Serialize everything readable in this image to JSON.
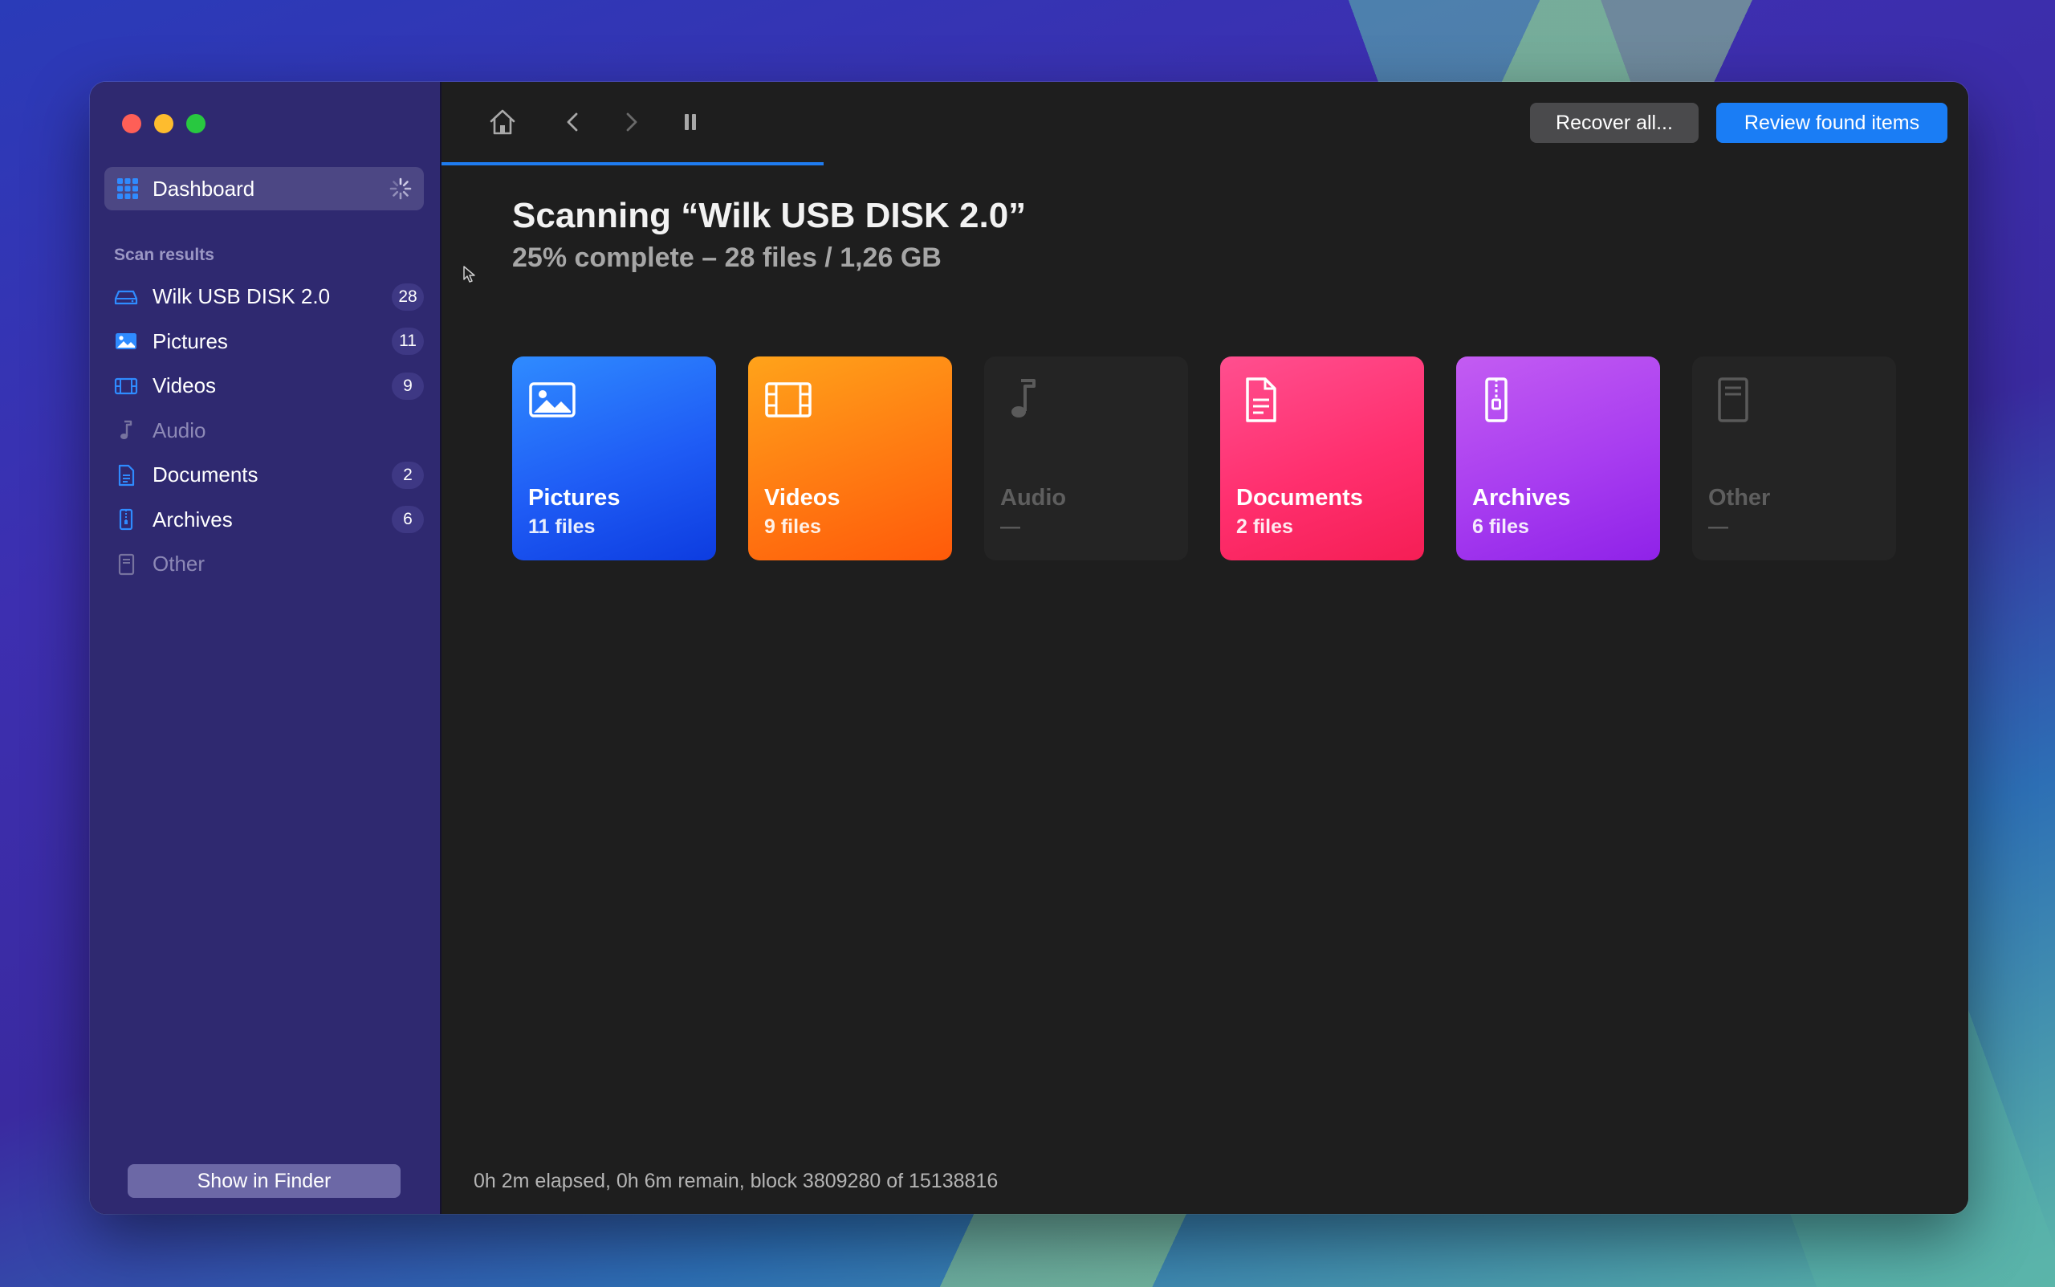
{
  "sidebar": {
    "dashboard_label": "Dashboard",
    "section_label": "Scan results",
    "items": [
      {
        "label": "Wilk USB DISK 2.0",
        "count": "28",
        "icon": "drive-icon",
        "active": true
      },
      {
        "label": "Pictures",
        "count": "11",
        "icon": "picture-icon",
        "active": true
      },
      {
        "label": "Videos",
        "count": "9",
        "icon": "film-icon",
        "active": true
      },
      {
        "label": "Audio",
        "count": "",
        "icon": "music-note-icon",
        "active": false
      },
      {
        "label": "Documents",
        "count": "2",
        "icon": "document-icon",
        "active": true
      },
      {
        "label": "Archives",
        "count": "6",
        "icon": "archive-icon",
        "active": true
      },
      {
        "label": "Other",
        "count": "",
        "icon": "file-icon",
        "active": false
      }
    ],
    "show_in_finder_label": "Show in Finder"
  },
  "toolbar": {
    "recover_all_label": "Recover all...",
    "review_label": "Review found items",
    "scan_progress_fraction": 0.25
  },
  "main": {
    "title": "Scanning “Wilk USB DISK 2.0”",
    "subtitle": "25% complete – 28 files / 1,26 GB",
    "cards": [
      {
        "name": "Pictures",
        "count": "11 files"
      },
      {
        "name": "Videos",
        "count": "9 files"
      },
      {
        "name": "Audio",
        "count": "—"
      },
      {
        "name": "Documents",
        "count": "2 files"
      },
      {
        "name": "Archives",
        "count": "6 files"
      },
      {
        "name": "Other",
        "count": "—"
      }
    ],
    "status": "0h 2m elapsed, 0h 6m remain, block 3809280 of 15138816"
  },
  "colors": {
    "accent": "#1a7df5",
    "sidebar": "#2f2970",
    "pictures": "#1f5cf5",
    "videos": "#ff7a12",
    "documents": "#ff2f6e",
    "archives": "#a83df0"
  }
}
